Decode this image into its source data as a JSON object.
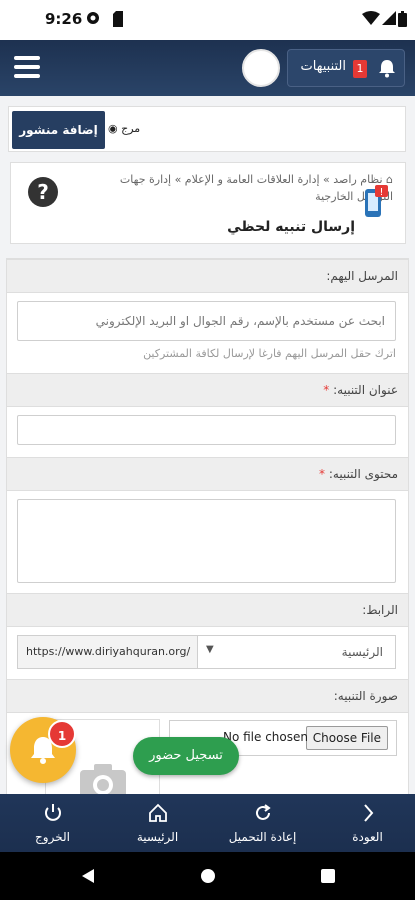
{
  "status_bar": {
    "time": "9:26"
  },
  "header": {
    "notifications_label": "التنبيهات",
    "notifications_count": "1"
  },
  "toolbar": {
    "add_post_label": "إضافة منشور",
    "mode_toggle_label": "مرج"
  },
  "page": {
    "breadcrumb": "نظام راصد » إدارة العلاقات العامة و الإعلام » إدارة جهات التواصل الخارجية",
    "title": "إرسال تنبيه لحظي"
  },
  "form": {
    "recipient": {
      "label": "المرسل اليهم:",
      "placeholder": "ابحث عن مستخدم بالإسم، رقم الجوال او البريد الإلكتروني",
      "help": "اترك حقل المرسل اليهم فارغا لإرسال لكافة المشتركين"
    },
    "alert_title": {
      "label": "عنوان التنبيه:",
      "required_mark": "*",
      "value": ""
    },
    "alert_content": {
      "label": "محتوى التنبيه:",
      "required_mark": "*",
      "value": ""
    },
    "link": {
      "label": "الرابط:",
      "selected_page": "الرئيسية",
      "base_url": "https://www.diriyahquran.org/"
    },
    "image": {
      "label": "صورة التنبيه:",
      "choose_file_label": "Choose File",
      "no_file_text": "No file chosen"
    }
  },
  "fab": {
    "badge_count": "1",
    "attend_label": "تسجيل حضور"
  },
  "bottom_nav": {
    "back": "العودة",
    "reload": "إعادة التحميل",
    "home": "الرئيسية",
    "logout": "الخروج"
  },
  "colors": {
    "header": "#1d3150",
    "accent_green": "#2e9e4f",
    "fab_yellow": "#f5b731",
    "badge_red": "#e53935"
  }
}
